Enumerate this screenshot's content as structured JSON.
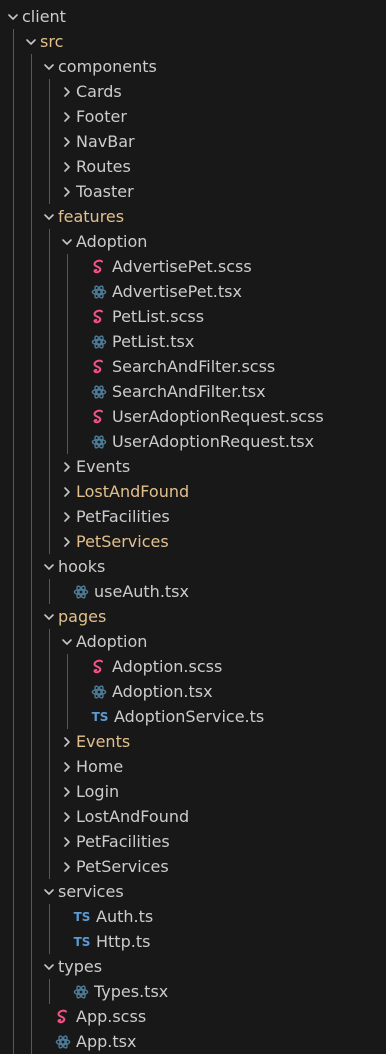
{
  "colors": {
    "background": "#181818",
    "text": "#cccccc",
    "modified_folder_text": "#e2c08d",
    "twistie": "#c5c5c5",
    "scss_icon": "#f55385",
    "tsx_icon": "#4d7a97",
    "ts_icon": "#5a9bd5",
    "indent_guide": "#585858"
  },
  "explorer": {
    "items": [
      {
        "label": "client",
        "type": "folder",
        "expanded": true,
        "depth": 0,
        "modified": false
      },
      {
        "label": "src",
        "type": "folder",
        "expanded": true,
        "depth": 1,
        "modified": true
      },
      {
        "label": "components",
        "type": "folder",
        "expanded": true,
        "depth": 2,
        "modified": false
      },
      {
        "label": "Cards",
        "type": "folder",
        "expanded": false,
        "depth": 3,
        "modified": false
      },
      {
        "label": "Footer",
        "type": "folder",
        "expanded": false,
        "depth": 3,
        "modified": false
      },
      {
        "label": "NavBar",
        "type": "folder",
        "expanded": false,
        "depth": 3,
        "modified": false
      },
      {
        "label": "Routes",
        "type": "folder",
        "expanded": false,
        "depth": 3,
        "modified": false
      },
      {
        "label": "Toaster",
        "type": "folder",
        "expanded": false,
        "depth": 3,
        "modified": false
      },
      {
        "label": "features",
        "type": "folder",
        "expanded": true,
        "depth": 2,
        "modified": true
      },
      {
        "label": "Adoption",
        "type": "folder",
        "expanded": true,
        "depth": 3,
        "modified": false
      },
      {
        "label": "AdvertisePet.scss",
        "type": "scss",
        "depth": 4
      },
      {
        "label": "AdvertisePet.tsx",
        "type": "tsx",
        "depth": 4
      },
      {
        "label": "PetList.scss",
        "type": "scss",
        "depth": 4
      },
      {
        "label": "PetList.tsx",
        "type": "tsx",
        "depth": 4
      },
      {
        "label": "SearchAndFilter.scss",
        "type": "scss",
        "depth": 4
      },
      {
        "label": "SearchAndFilter.tsx",
        "type": "tsx",
        "depth": 4
      },
      {
        "label": "UserAdoptionRequest.scss",
        "type": "scss",
        "depth": 4
      },
      {
        "label": "UserAdoptionRequest.tsx",
        "type": "tsx",
        "depth": 4
      },
      {
        "label": "Events",
        "type": "folder",
        "expanded": false,
        "depth": 3,
        "modified": false
      },
      {
        "label": "LostAndFound",
        "type": "folder",
        "expanded": false,
        "depth": 3,
        "modified": true
      },
      {
        "label": "PetFacilities",
        "type": "folder",
        "expanded": false,
        "depth": 3,
        "modified": false
      },
      {
        "label": "PetServices",
        "type": "folder",
        "expanded": false,
        "depth": 3,
        "modified": true
      },
      {
        "label": "hooks",
        "type": "folder",
        "expanded": true,
        "depth": 2,
        "modified": false
      },
      {
        "label": "useAuth.tsx",
        "type": "tsx",
        "depth": 3
      },
      {
        "label": "pages",
        "type": "folder",
        "expanded": true,
        "depth": 2,
        "modified": true
      },
      {
        "label": "Adoption",
        "type": "folder",
        "expanded": true,
        "depth": 3,
        "modified": false
      },
      {
        "label": "Adoption.scss",
        "type": "scss",
        "depth": 4
      },
      {
        "label": "Adoption.tsx",
        "type": "tsx",
        "depth": 4
      },
      {
        "label": "AdoptionService.ts",
        "type": "ts",
        "depth": 4
      },
      {
        "label": "Events",
        "type": "folder",
        "expanded": false,
        "depth": 3,
        "modified": true
      },
      {
        "label": "Home",
        "type": "folder",
        "expanded": false,
        "depth": 3,
        "modified": false
      },
      {
        "label": "Login",
        "type": "folder",
        "expanded": false,
        "depth": 3,
        "modified": false
      },
      {
        "label": "LostAndFound",
        "type": "folder",
        "expanded": false,
        "depth": 3,
        "modified": false
      },
      {
        "label": "PetFacilities",
        "type": "folder",
        "expanded": false,
        "depth": 3,
        "modified": false
      },
      {
        "label": "PetServices",
        "type": "folder",
        "expanded": false,
        "depth": 3,
        "modified": false
      },
      {
        "label": "services",
        "type": "folder",
        "expanded": true,
        "depth": 2,
        "modified": false
      },
      {
        "label": "Auth.ts",
        "type": "ts",
        "depth": 3
      },
      {
        "label": "Http.ts",
        "type": "ts",
        "depth": 3
      },
      {
        "label": "types",
        "type": "folder",
        "expanded": true,
        "depth": 2,
        "modified": false
      },
      {
        "label": "Types.tsx",
        "type": "tsx",
        "depth": 3
      },
      {
        "label": "App.scss",
        "type": "scss",
        "depth": 2
      },
      {
        "label": "App.tsx",
        "type": "tsx",
        "depth": 2
      }
    ],
    "ts_badge": "TS"
  }
}
